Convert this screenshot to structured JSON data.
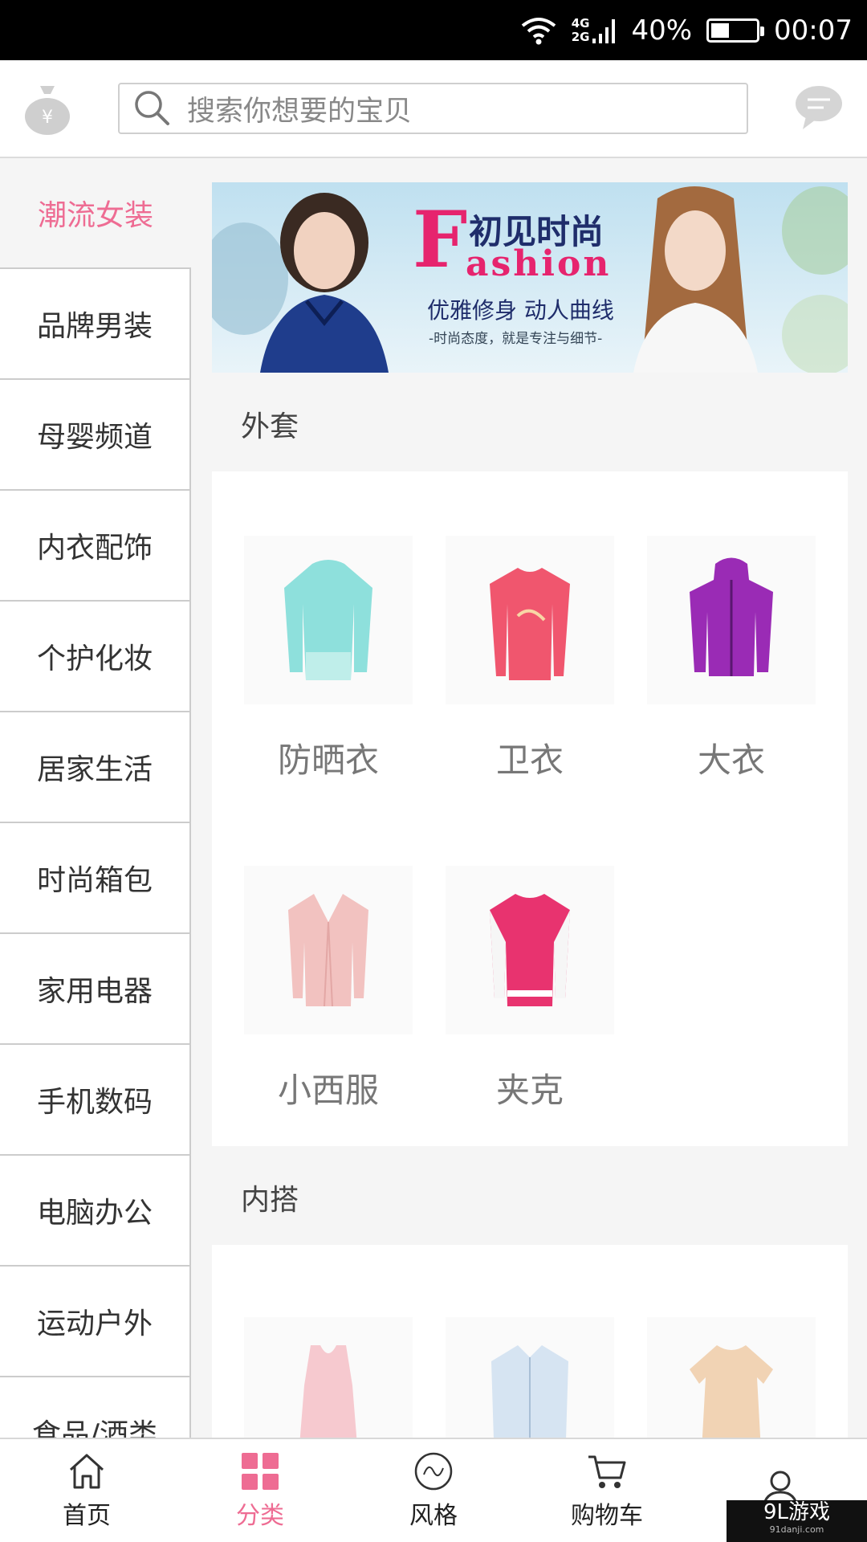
{
  "status_bar": {
    "net_top": "4G",
    "net_bottom": "2G",
    "battery": "40%",
    "battery_level": 0.4,
    "time": "00:07"
  },
  "search": {
    "placeholder": "搜索你想要的宝贝"
  },
  "sidebar": {
    "items": [
      {
        "label": "潮流女装",
        "active": true
      },
      {
        "label": "品牌男装"
      },
      {
        "label": "母婴频道"
      },
      {
        "label": "内衣配饰"
      },
      {
        "label": "个护化妆"
      },
      {
        "label": "居家生活"
      },
      {
        "label": "时尚箱包"
      },
      {
        "label": "家用电器"
      },
      {
        "label": "手机数码"
      },
      {
        "label": "电脑办公"
      },
      {
        "label": "运动户外"
      },
      {
        "label": "食品/酒类"
      }
    ]
  },
  "banner": {
    "title_cn": "初见时尚",
    "title_letter": "F",
    "title_en": "ashion",
    "subtitle": "优雅修身 动人曲线",
    "tagline": "-时尚态度，就是专注与细节-"
  },
  "sections": [
    {
      "title": "外套",
      "items": [
        {
          "label": "防晒衣",
          "color": "#8ee0dc"
        },
        {
          "label": "卫衣",
          "color": "#f0566e"
        },
        {
          "label": "大衣",
          "color": "#9a2bb5"
        },
        {
          "label": "小西服",
          "color": "#f2c2c0"
        },
        {
          "label": "夹克",
          "color": "#e8336f"
        }
      ]
    },
    {
      "title": "内搭",
      "items": [
        {
          "label": "",
          "color": "#f6c9cf"
        },
        {
          "label": "",
          "color": "#d6e4f2"
        },
        {
          "label": "",
          "color": "#f1d3b4"
        }
      ]
    }
  ],
  "bottom_nav": [
    {
      "label": "首页",
      "icon": "home-icon"
    },
    {
      "label": "分类",
      "icon": "category-icon",
      "active": true
    },
    {
      "label": "风格",
      "icon": "style-icon"
    },
    {
      "label": "购物车",
      "icon": "cart-icon"
    },
    {
      "label": "",
      "icon": "profile-icon"
    }
  ],
  "watermark": {
    "main": "9L游戏",
    "sub": "91danji.com"
  },
  "colors": {
    "accent": "#ee6c93"
  }
}
